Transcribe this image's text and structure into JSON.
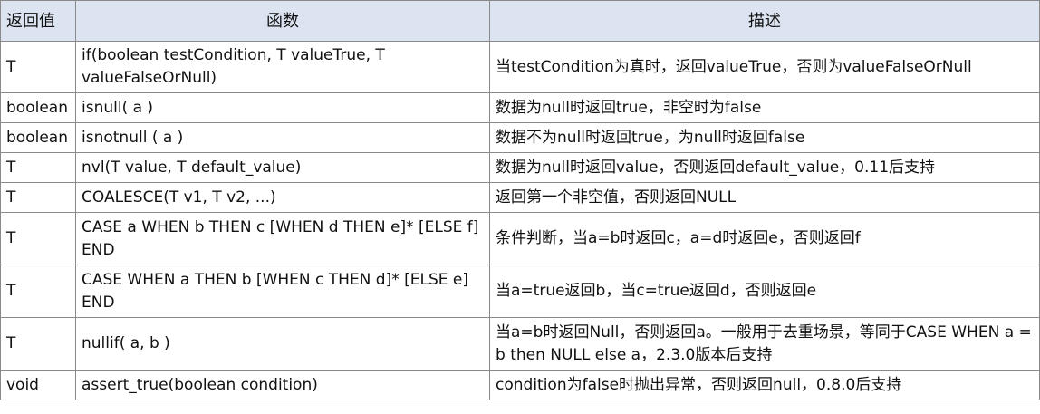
{
  "headers": [
    "返回值",
    "函数",
    "描述"
  ],
  "rows": [
    {
      "ret": "T",
      "func": "if(boolean testCondition, T valueTrue, T valueFalseOrNull)",
      "desc": "当testCondition为真时，返回valueTrue，否则为valueFalseOrNull"
    },
    {
      "ret": "boolean",
      "func": "isnull( a )",
      "desc": "数据为null时返回true，非空时为false"
    },
    {
      "ret": "boolean",
      "func": "isnotnull ( a )",
      "desc": "数据不为null时返回true，为null时返回false"
    },
    {
      "ret": "T",
      "func": "nvl(T value, T default_value)",
      "desc": "数据为null时返回value，否则返回default_value，0.11后支持"
    },
    {
      "ret": "T",
      "func": "COALESCE(T v1, T v2, ...)",
      "desc": "返回第一个非空值，否则返回NULL"
    },
    {
      "ret": "T",
      "func": "CASE a WHEN b THEN c [WHEN d THEN e]* [ELSE f] END",
      "desc": "条件判断，当a=b时返回c，a=d时返回e，否则返回f"
    },
    {
      "ret": "T",
      "func": "CASE WHEN a THEN b [WHEN c THEN d]* [ELSE e] END",
      "desc": "当a=true返回b，当c=true返回d，否则返回e"
    },
    {
      "ret": "T",
      "func": "nullif( a, b )",
      "desc": "当a=b时返回Null，否则返回a。一般用于去重场景，等同于CASE WHEN a = b then NULL else a，2.3.0版本后支持"
    },
    {
      "ret": "void",
      "func": "assert_true(boolean  condition)",
      "desc": "condition为false时抛出异常，否则返回null，0.8.0后支持"
    }
  ]
}
